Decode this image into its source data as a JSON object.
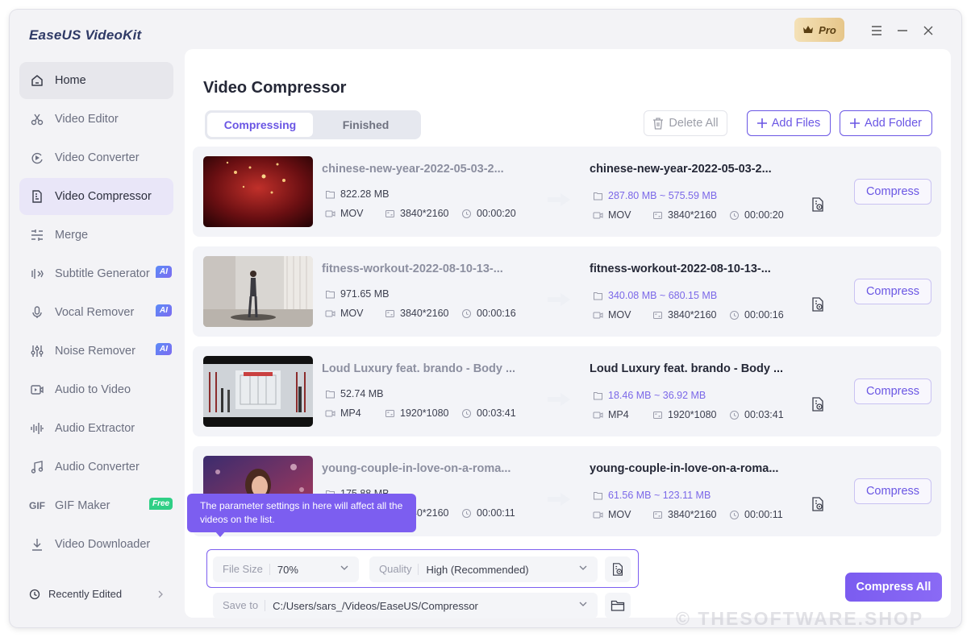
{
  "app": {
    "title": "EaseUS VideoKit",
    "pro_label": "Pro"
  },
  "sidebar": {
    "items": [
      {
        "label": "Home"
      },
      {
        "label": "Video Editor"
      },
      {
        "label": "Video Converter"
      },
      {
        "label": "Video Compressor"
      },
      {
        "label": "Merge"
      },
      {
        "label": "Subtitle Generator",
        "badge": "AI"
      },
      {
        "label": "Vocal Remover",
        "badge": "AI"
      },
      {
        "label": "Noise Remover",
        "badge": "AI"
      },
      {
        "label": "Audio to Video"
      },
      {
        "label": "Audio Extractor"
      },
      {
        "label": "Audio Converter"
      },
      {
        "label": "GIF Maker",
        "badge": "Free"
      },
      {
        "label": "Video Downloader"
      }
    ],
    "active": "Video Compressor",
    "recently_edited": "Recently Edited"
  },
  "main": {
    "title": "Video Compressor",
    "tabs": [
      {
        "label": "Compressing",
        "selected": true
      },
      {
        "label": "Finished",
        "selected": false
      }
    ],
    "delete_all": "Delete All",
    "add_files": "Add Files",
    "add_folder": "Add Folder",
    "compress_label": "Compress",
    "files": [
      {
        "src_name": "chinese-new-year-2022-05-03-2...",
        "src_size": "822.28 MB",
        "format": "MOV",
        "resolution": "3840*2160",
        "duration": "00:00:20",
        "dst_name": "chinese-new-year-2022-05-03-2...",
        "dst_size": "287.80 MB ~ 575.59 MB"
      },
      {
        "src_name": "fitness-workout-2022-08-10-13-...",
        "src_size": "971.65 MB",
        "format": "MOV",
        "resolution": "3840*2160",
        "duration": "00:00:16",
        "dst_name": "fitness-workout-2022-08-10-13-...",
        "dst_size": "340.08 MB ~ 680.15 MB"
      },
      {
        "src_name": "Loud Luxury feat. brando - Body ...",
        "src_size": "52.74 MB",
        "format": "MP4",
        "resolution": "1920*1080",
        "duration": "00:03:41",
        "dst_name": "Loud Luxury feat. brando - Body ...",
        "dst_size": "18.46 MB ~ 36.92 MB"
      },
      {
        "src_name": "young-couple-in-love-on-a-roma...",
        "src_size": "175.88 MB",
        "format": "MOV",
        "resolution": "3840*2160",
        "duration": "00:00:11",
        "dst_name": "young-couple-in-love-on-a-roma...",
        "dst_size": "61.56 MB ~ 123.11 MB"
      }
    ],
    "tooltip": "The parameter settings in here will affect all the videos on the list.",
    "file_size_label": "File Size",
    "file_size_value": "70%",
    "quality_label": "Quality",
    "quality_value": "High (Recommended)",
    "save_to_label": "Save to",
    "save_to_value": "C:/Users/sars_/Videos/EaseUS/Compressor",
    "compress_all": "Compress All"
  },
  "watermark": "© THESOFTWARE.SHOP",
  "colors": {
    "accent": "#6a56e4",
    "tooltip_bg": "#7c5ef0",
    "destination_size": "#7b68e8"
  }
}
